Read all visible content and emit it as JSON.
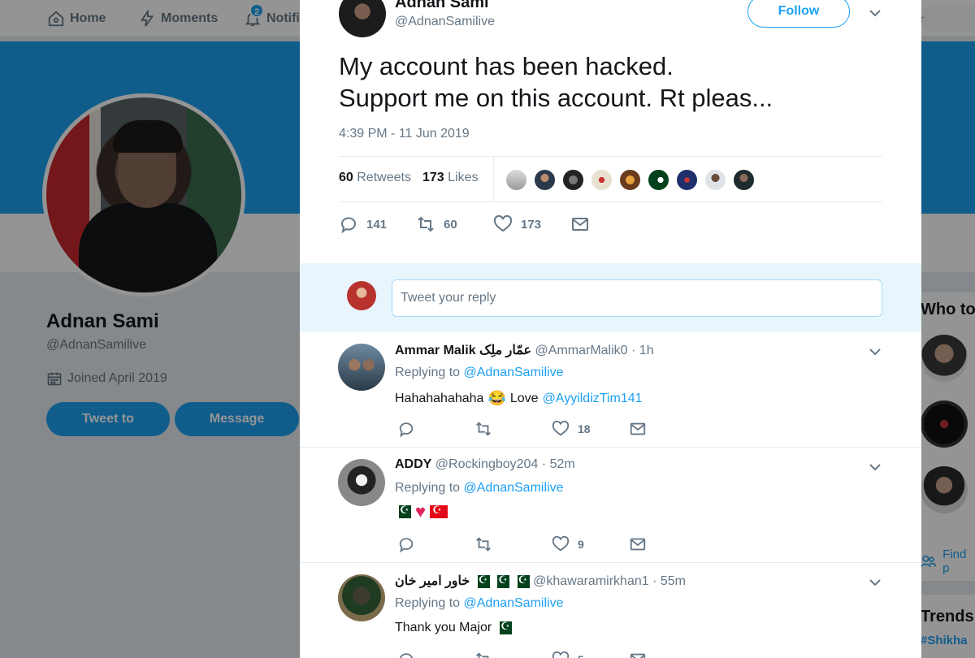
{
  "nav": {
    "home": "Home",
    "moments": "Moments",
    "notifications": "Notifi",
    "notif_count": "2",
    "search_hint": "r"
  },
  "profile": {
    "name": "Adnan Sami",
    "handle": "@AdnanSamilive",
    "joined": "Joined April 2019",
    "tweet_to": "Tweet to",
    "message": "Message"
  },
  "sidebar": {
    "who_to_follow": "Who to",
    "find": "Find p",
    "trends": "Trends",
    "trend_tag": "#Shikha"
  },
  "tweet": {
    "author_name": "Adnan Sami",
    "author_handle": "@AdnanSamilive",
    "follow_label": "Follow",
    "text": "My account has been hacked.\nSupport me on this account. Rt pleas...",
    "timestamp": "4:39 PM - 11 Jun 2019",
    "retweet_count": "60",
    "retweets_label": "Retweets",
    "like_count": "173",
    "likes_label": "Likes",
    "reply_count": "141",
    "retweet_action_count": "60",
    "like_action_count": "173"
  },
  "reply_box": {
    "placeholder": "Tweet your reply"
  },
  "replies": [
    {
      "name": "Ammar Malik عمّار ملِک",
      "handle": "@AmmarMalik0",
      "time": "· 1h",
      "replying_prefix": "Replying to",
      "replying_to": "@AdnanSamilive",
      "text": "Hahahahahaha",
      "emoji": "😂",
      "text_after": "Love",
      "mention": "@AyyildizTim141",
      "reply_count": "",
      "retweet_count": "",
      "like_count": "18"
    },
    {
      "name": "ADDY",
      "handle": "@Rockingboy204",
      "time": "· 52m",
      "replying_prefix": "Replying to",
      "replying_to": "@AdnanSamilive",
      "reply_count": "",
      "retweet_count": "",
      "like_count": "9"
    },
    {
      "name": "خاور امیر خان",
      "handle": "@khawaramirkhan1",
      "time": "· 55m",
      "replying_prefix": "Replying to",
      "replying_to": "@AdnanSamilive",
      "text": "Thank you Major",
      "reply_count": "",
      "retweet_count": "",
      "like_count": "5"
    }
  ],
  "colors": {
    "accent": "#1da1f2",
    "text": "#14171a",
    "muted": "#657786",
    "like": "#e0245e"
  }
}
